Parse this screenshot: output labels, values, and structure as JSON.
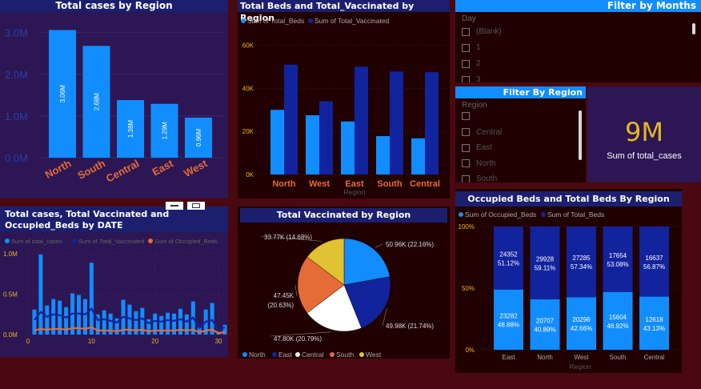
{
  "total_cases": {
    "title": "Total cases by Region",
    "y_ticks": [
      "0.0M",
      "1.0M",
      "2.0M",
      "3.0M"
    ]
  },
  "beds_vacc": {
    "title": "Total Beds and Total_Vaccinated by Region",
    "legend": [
      "Sum of Total_Beds",
      "Sum of Total_Vaccinated"
    ],
    "y_ticks": [
      "0K",
      "20K",
      "40K",
      "60K"
    ],
    "xlabel": "Region"
  },
  "filter_months": {
    "title": "Filter by Months",
    "field": "Day",
    "items": [
      "(Blank)",
      "1",
      "2",
      "3"
    ]
  },
  "filter_region": {
    "title": "Filter By Region",
    "field": "Region",
    "items": [
      "",
      "Central",
      "East",
      "North",
      "South"
    ]
  },
  "kpi": {
    "value": "9M",
    "label": "Sum of total_cases"
  },
  "by_date": {
    "title_line1": "Total cases, Total Vaccinated and",
    "title_line2": "Occupied_Beds by DATE",
    "legend": [
      "Sum of total_cases",
      "Sum of Total_Vaccinated",
      "Sum of Occupied_Beds"
    ],
    "y_ticks": [
      "0.0M",
      "0.5M",
      "1.0M"
    ],
    "x_ticks": [
      "0",
      "10",
      "20",
      "30"
    ]
  },
  "pie": {
    "title": "Total Vaccinated by Region",
    "legend": [
      "North",
      "East",
      "Central",
      "South",
      "West"
    ]
  },
  "occupied": {
    "title": "Occupied Beds and Total Beds By Region",
    "legend": [
      "Sum of Occupied_Beds",
      "Sum of Total_Beds"
    ],
    "y_ticks": [
      "0%",
      "50%",
      "100%"
    ],
    "xlabel": "Region"
  },
  "colors": {
    "bg": "#4a0810",
    "panel_dark": "#200000",
    "panel_purple": "#2c1654",
    "header_navy": "#1b1f6e",
    "light_blue": "#118dff",
    "dark_blue": "#12239e",
    "orange": "#e66c37",
    "yellow": "#e1c233",
    "kpi_yellow": "#e6b820",
    "tick_orange": "#e66c37"
  },
  "chart_data": [
    {
      "type": "bar",
      "title": "Total cases by Region",
      "categories": [
        "North",
        "South",
        "Central",
        "East",
        "West"
      ],
      "values": [
        3.06,
        2.68,
        1.38,
        1.29,
        0.96
      ],
      "data_labels": [
        "3.06M",
        "2.68M",
        "1.38M",
        "1.29M",
        "0.96M"
      ],
      "units": "M",
      "ylim": [
        0,
        3.3
      ]
    },
    {
      "type": "bar",
      "title": "Total Beds and Total_Vaccinated by Region",
      "categories": [
        "North",
        "West",
        "East",
        "South",
        "Central"
      ],
      "series": [
        {
          "name": "Sum of Total_Beds",
          "values": [
            30000,
            27500,
            24600,
            17800,
            16800
          ]
        },
        {
          "name": "Sum of Total_Vaccinated",
          "values": [
            50960,
            34000,
            49980,
            47800,
            47450
          ]
        }
      ],
      "ylim": [
        0,
        62000
      ],
      "xlabel": "Region"
    },
    {
      "type": "line",
      "title": "Total cases, Total Vaccinated and Occupied_Beds by DATE",
      "x": [
        1,
        2,
        3,
        4,
        5,
        6,
        7,
        8,
        9,
        10,
        11,
        12,
        13,
        14,
        15,
        16,
        17,
        18,
        19,
        20,
        21,
        22,
        23,
        24,
        25,
        26,
        27,
        28,
        29,
        30,
        31
      ],
      "series": [
        {
          "name": "Sum of total_cases",
          "values": [
            0.31,
            0.99,
            0.36,
            0.44,
            0.42,
            0.34,
            0.51,
            0.49,
            0.44,
            0.89,
            0.25,
            0.3,
            0.26,
            0.2,
            0.43,
            0.37,
            0.29,
            0.33,
            0.19,
            0.26,
            0.23,
            0.27,
            0.26,
            0.32,
            0.25,
            0.41,
            0.09,
            0.31,
            0.39,
            0.03,
            0.12
          ]
        },
        {
          "name": "Sum of Total_Vaccinated",
          "values": [
            0.18,
            0.28,
            0.22,
            0.25,
            0.24,
            0.21,
            0.26,
            0.26,
            0.25,
            0.32,
            0.18,
            0.19,
            0.17,
            0.15,
            0.22,
            0.2,
            0.18,
            0.2,
            0.14,
            0.17,
            0.16,
            0.18,
            0.17,
            0.19,
            0.16,
            0.21,
            0.08,
            0.16,
            0.18,
            0.05,
            0.09
          ]
        },
        {
          "name": "Sum of Occupied_Beds",
          "values": [
            0.05,
            0.07,
            0.06,
            0.07,
            0.07,
            0.06,
            0.08,
            0.08,
            0.07,
            0.09,
            0.05,
            0.05,
            0.05,
            0.04,
            0.06,
            0.06,
            0.05,
            0.06,
            0.04,
            0.05,
            0.05,
            0.05,
            0.05,
            0.06,
            0.05,
            0.06,
            0.03,
            0.05,
            0.06,
            0.02,
            0.03
          ]
        }
      ],
      "ylim": [
        0,
        1.05
      ],
      "xlim": [
        0,
        31
      ]
    },
    {
      "type": "pie",
      "title": "Total Vaccinated by Region",
      "categories": [
        "North",
        "East",
        "Central",
        "South",
        "West"
      ],
      "values": [
        50.96,
        49.98,
        47.8,
        47.45,
        33.77
      ],
      "percents": [
        22.16,
        21.74,
        20.79,
        20.63,
        14.68
      ],
      "labels": [
        "50.96K (22.16%)",
        "49.98K (21.74%)",
        "47.80K (20.79%)",
        "47.45K (20.63%)",
        "33.77K (14.68%)"
      ],
      "colors": [
        "#118dff",
        "#12239e",
        "#ffffff",
        "#e66c37",
        "#e1c233"
      ]
    },
    {
      "type": "bar",
      "title": "Occupied Beds and Total Beds By Region",
      "stacked": "100%",
      "categories": [
        "East",
        "North",
        "West",
        "South",
        "Central"
      ],
      "series": [
        {
          "name": "Sum of Occupied_Beds",
          "values": [
            23282,
            20707,
            20296,
            15604,
            12618
          ],
          "percents": [
            "48.88%",
            "40.89%",
            "42.66%",
            "46.92%",
            "43.13%"
          ]
        },
        {
          "name": "Sum of Total_Beds",
          "values": [
            24352,
            29928,
            27285,
            17654,
            16637
          ],
          "percents": [
            "51.12%",
            "59.11%",
            "57.34%",
            "53.08%",
            "56.87%"
          ]
        }
      ],
      "xlabel": "Region"
    }
  ]
}
